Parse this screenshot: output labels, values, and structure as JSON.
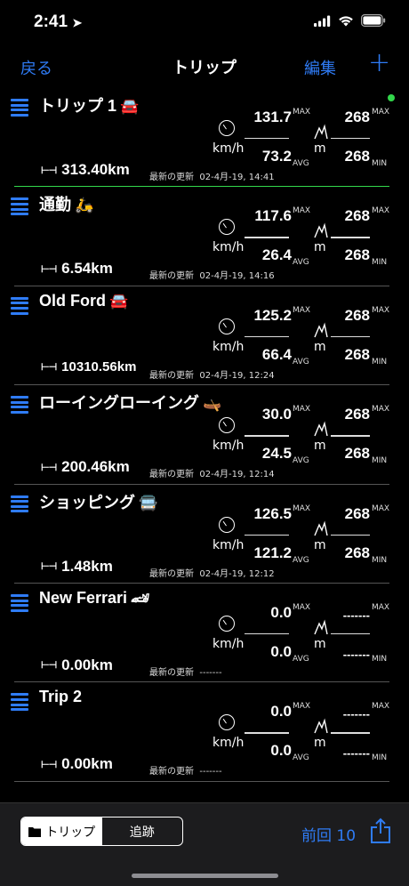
{
  "status": {
    "time": "2:41"
  },
  "nav": {
    "back": "戻る",
    "title": "トリップ",
    "edit": "編集",
    "add": "+"
  },
  "updated_label": "最新の更新",
  "units": {
    "speed": "km/h",
    "alt": "m",
    "max": "MAX",
    "avg": "AVG",
    "min": "MIN"
  },
  "trips": [
    {
      "name": "トリップ 1",
      "emoji": "🚘",
      "distance": "313.40km",
      "updated": "02-4月-19, 14:41",
      "speed_max": "131.7",
      "speed_avg": "73.2",
      "alt_max": "268",
      "alt_min": "268",
      "active": true
    },
    {
      "name": "通勤",
      "emoji": "🛵",
      "distance": "6.54km",
      "updated": "02-4月-19, 14:16",
      "speed_max": "117.6",
      "speed_avg": "26.4",
      "alt_max": "268",
      "alt_min": "268"
    },
    {
      "name": "Old Ford",
      "emoji": "🚘",
      "distance": "10310.56km",
      "updated": "02-4月-19, 12:24",
      "speed_max": "125.2",
      "speed_avg": "66.4",
      "alt_max": "268",
      "alt_min": "268"
    },
    {
      "name": "ローイングローイング",
      "emoji": "🛶",
      "distance": "200.46km",
      "updated": "02-4月-19, 12:14",
      "speed_max": "30.0",
      "speed_avg": "24.5",
      "alt_max": "268",
      "alt_min": "268"
    },
    {
      "name": "ショッピング",
      "emoji": "🚍",
      "distance": "1.48km",
      "updated": "02-4月-19, 12:12",
      "speed_max": "126.5",
      "speed_avg": "121.2",
      "alt_max": "268",
      "alt_min": "268"
    },
    {
      "name": "New Ferrari",
      "emoji": "🏎",
      "distance": "0.00km",
      "updated": "-------",
      "speed_max": "0.0",
      "speed_avg": "0.0",
      "alt_max": "-------",
      "alt_min": "-------"
    },
    {
      "name": "Trip 2",
      "emoji": "",
      "distance": "0.00km",
      "updated": "-------",
      "speed_max": "0.0",
      "speed_avg": "0.0",
      "alt_max": "-------",
      "alt_min": "-------"
    }
  ],
  "toolbar": {
    "seg_trip": "トリップ",
    "seg_track": "追跡",
    "prev": "前回 10"
  },
  "colors": {
    "accent": "#2f7cf6",
    "active_dot": "#32d74b"
  }
}
